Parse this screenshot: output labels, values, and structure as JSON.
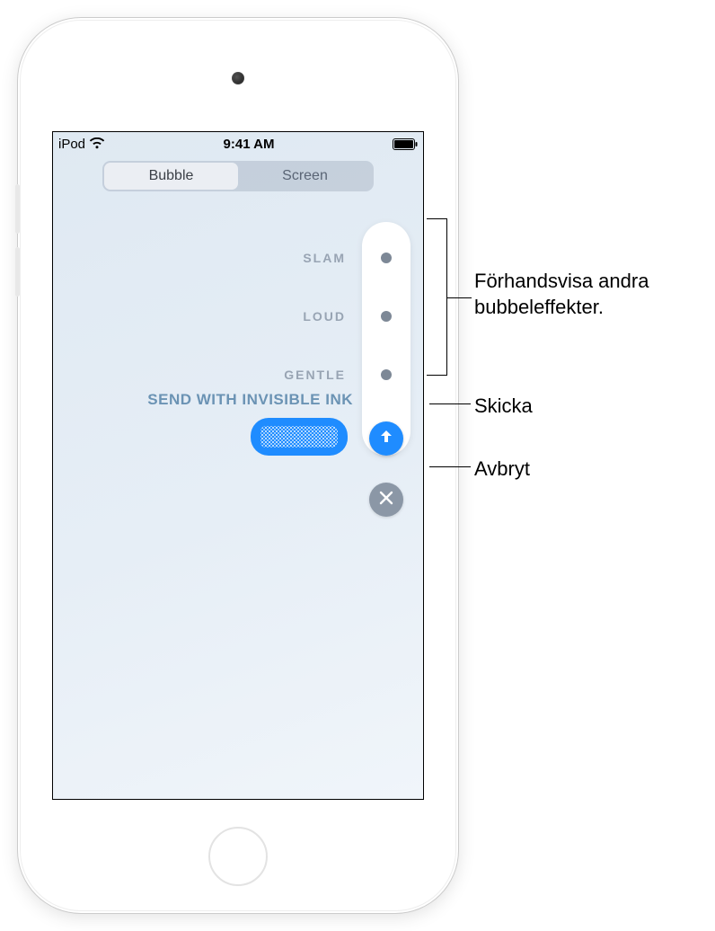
{
  "status": {
    "carrier": "iPod",
    "time": "9:41 AM"
  },
  "tabs": {
    "bubble": "Bubble",
    "screen": "Screen"
  },
  "effects": {
    "slam": "SLAM",
    "loud": "LOUD",
    "gentle": "GENTLE",
    "invisible_ink": "SEND WITH INVISIBLE INK"
  },
  "callouts": {
    "preview": "Förhandsvisa andra bubbeleffekter.",
    "send": "Skicka",
    "cancel": "Avbryt"
  }
}
